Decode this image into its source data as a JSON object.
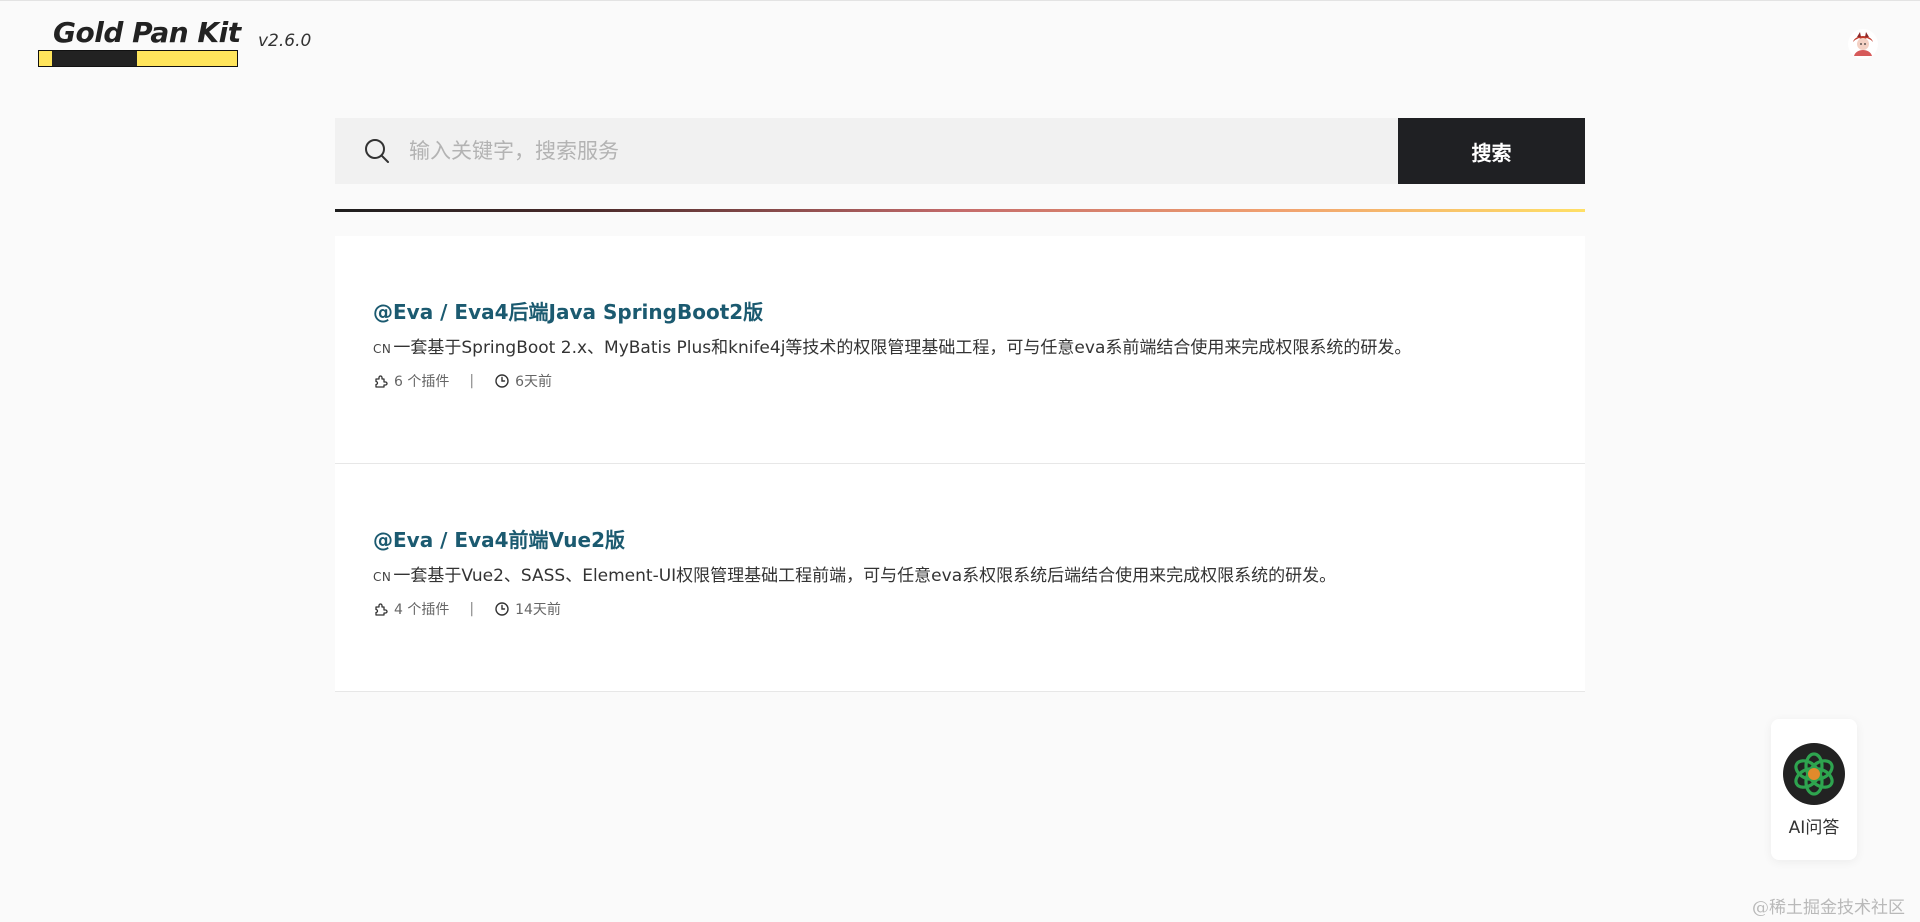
{
  "header": {
    "logo_text": "Gold Pan Kit",
    "version": "v2.6.0",
    "avatar_icon": "user-avatar-icon"
  },
  "search": {
    "placeholder": "输入关键字，搜索服务",
    "value": "",
    "button_label": "搜索",
    "icon": "search-icon"
  },
  "results": [
    {
      "title": "@Eva / Eva4后端Java SpringBoot2版",
      "lang": "CN",
      "description": "一套基于SpringBoot 2.x、MyBatis Plus和knife4j等技术的权限管理基础工程，可与任意eva系前端结合使用来完成权限系统的研发。",
      "plugins": "6 个插件",
      "separator": "|",
      "updated": "6天前"
    },
    {
      "title": "@Eva / Eva4前端Vue2版",
      "lang": "CN",
      "description": "一套基于Vue2、SASS、Element-UI权限管理基础工程前端，可与任意eva系权限系统后端结合使用来完成权限系统的研发。",
      "plugins": "4 个插件",
      "separator": "|",
      "updated": "14天前"
    }
  ],
  "ai_widget": {
    "label": "AI问答",
    "icon": "openai-logo-icon"
  },
  "watermark": "@稀土掘金技术社区",
  "colors": {
    "accent_dark": "#1f2023",
    "title_link": "#1b5a70",
    "logo_yellow": "#ffe55c",
    "ai_icon_green": "#2ea44f"
  }
}
